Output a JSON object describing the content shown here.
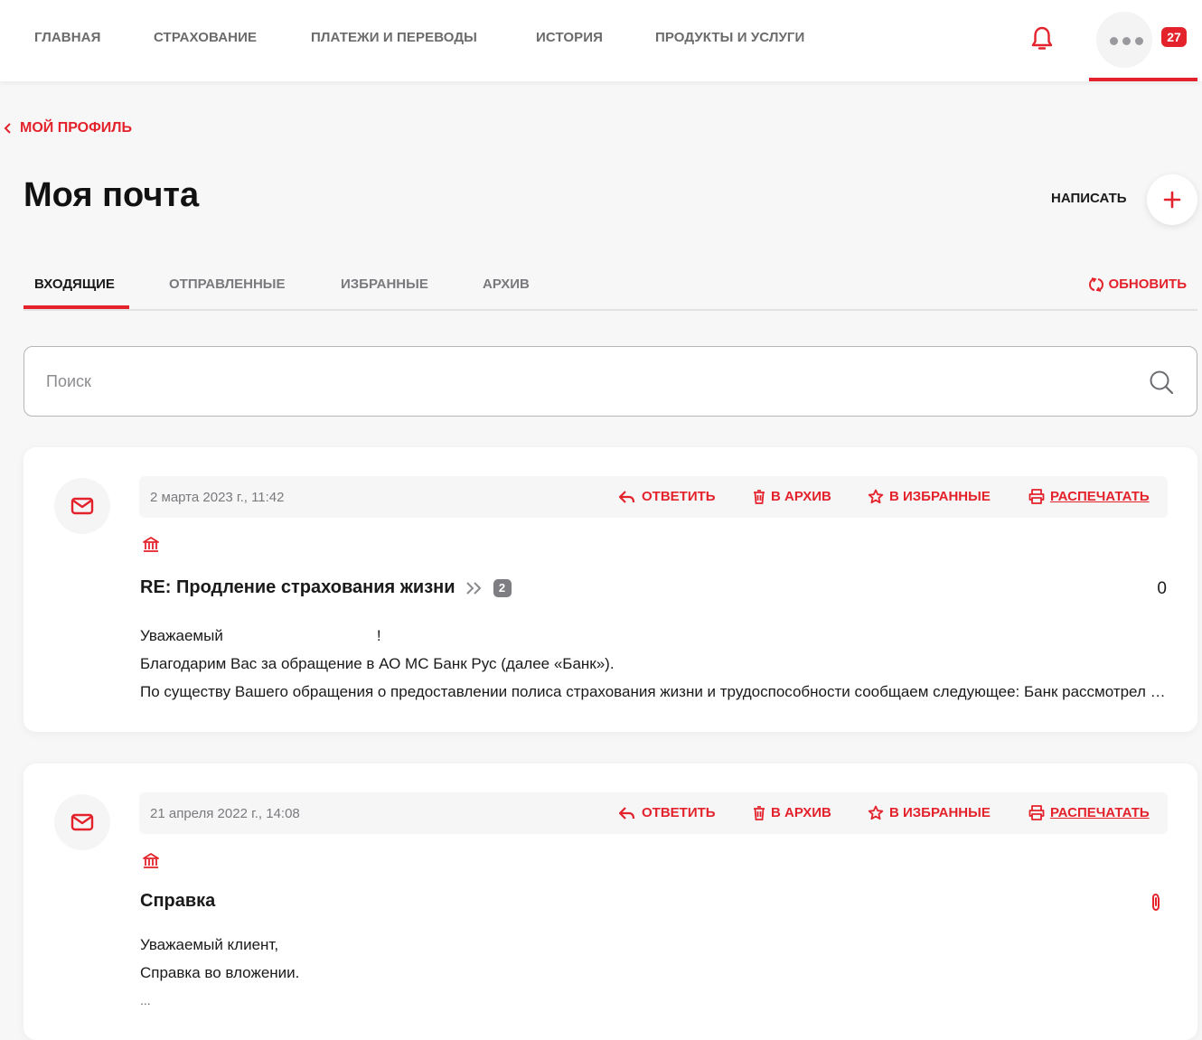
{
  "colors": {
    "accent": "#e3222b",
    "muted": "#7a7a7e"
  },
  "topnav": {
    "items": [
      {
        "label": "ГЛАВНАЯ"
      },
      {
        "label": "СТРАХОВАНИЕ"
      },
      {
        "label": "ПЛАТЕЖИ И ПЕРЕВОДЫ"
      },
      {
        "label": "ИСТОРИЯ"
      },
      {
        "label": "ПРОДУКТЫ И УСЛУГИ"
      }
    ],
    "notifications_icon": "bell-icon",
    "more_icon": "more-dots-icon",
    "badge_count": "27"
  },
  "breadcrumb": {
    "back_label": "МОЙ ПРОФИЛЬ",
    "back_icon": "chevron-left-icon"
  },
  "page": {
    "title": "Моя почта",
    "compose_label": "НАПИСАТЬ",
    "compose_icon": "plus-icon"
  },
  "tabs": {
    "items": [
      {
        "label": "ВХОДЯЩИЕ",
        "active": true
      },
      {
        "label": "ОТПРАВЛЕННЫЕ",
        "active": false
      },
      {
        "label": "ИЗБРАННЫЕ",
        "active": false
      },
      {
        "label": "АРХИВ",
        "active": false
      }
    ],
    "refresh_label": "ОБНОВИТЬ",
    "refresh_icon": "refresh-icon"
  },
  "search": {
    "placeholder": "Поиск",
    "value": "",
    "icon": "search-icon"
  },
  "actions": {
    "reply": "ОТВЕТИТЬ",
    "archive": "В АРХИВ",
    "favorite": "В ИЗБРАННЫЕ",
    "print": "РАСПЕЧАТАТЬ"
  },
  "messages": [
    {
      "date": "2 марта 2023 г., 11:42",
      "subject": "RE: Продление страхования жизни",
      "thread_count": "2",
      "right_value": "0",
      "sender_icon": "bank-icon",
      "preview": [
        "Уважаемый                                    !",
        "Благодарим Вас за обращение в АО МС Банк Рус (далее «Банк»).",
        "По существу Вашего обращения о предоставлении полиса страхования жизни и трудоспособности сообщаем следующее: Банк рассмотрел Ваше обращение"
      ]
    },
    {
      "date": "21 апреля 2022 г., 14:08",
      "subject": "Справка",
      "has_attachment": true,
      "attachment_icon": "paperclip-icon",
      "sender_icon": "bank-icon",
      "preview": [
        "Уважаемый клиент,",
        "Справка во вложении.",
        "..."
      ]
    }
  ]
}
